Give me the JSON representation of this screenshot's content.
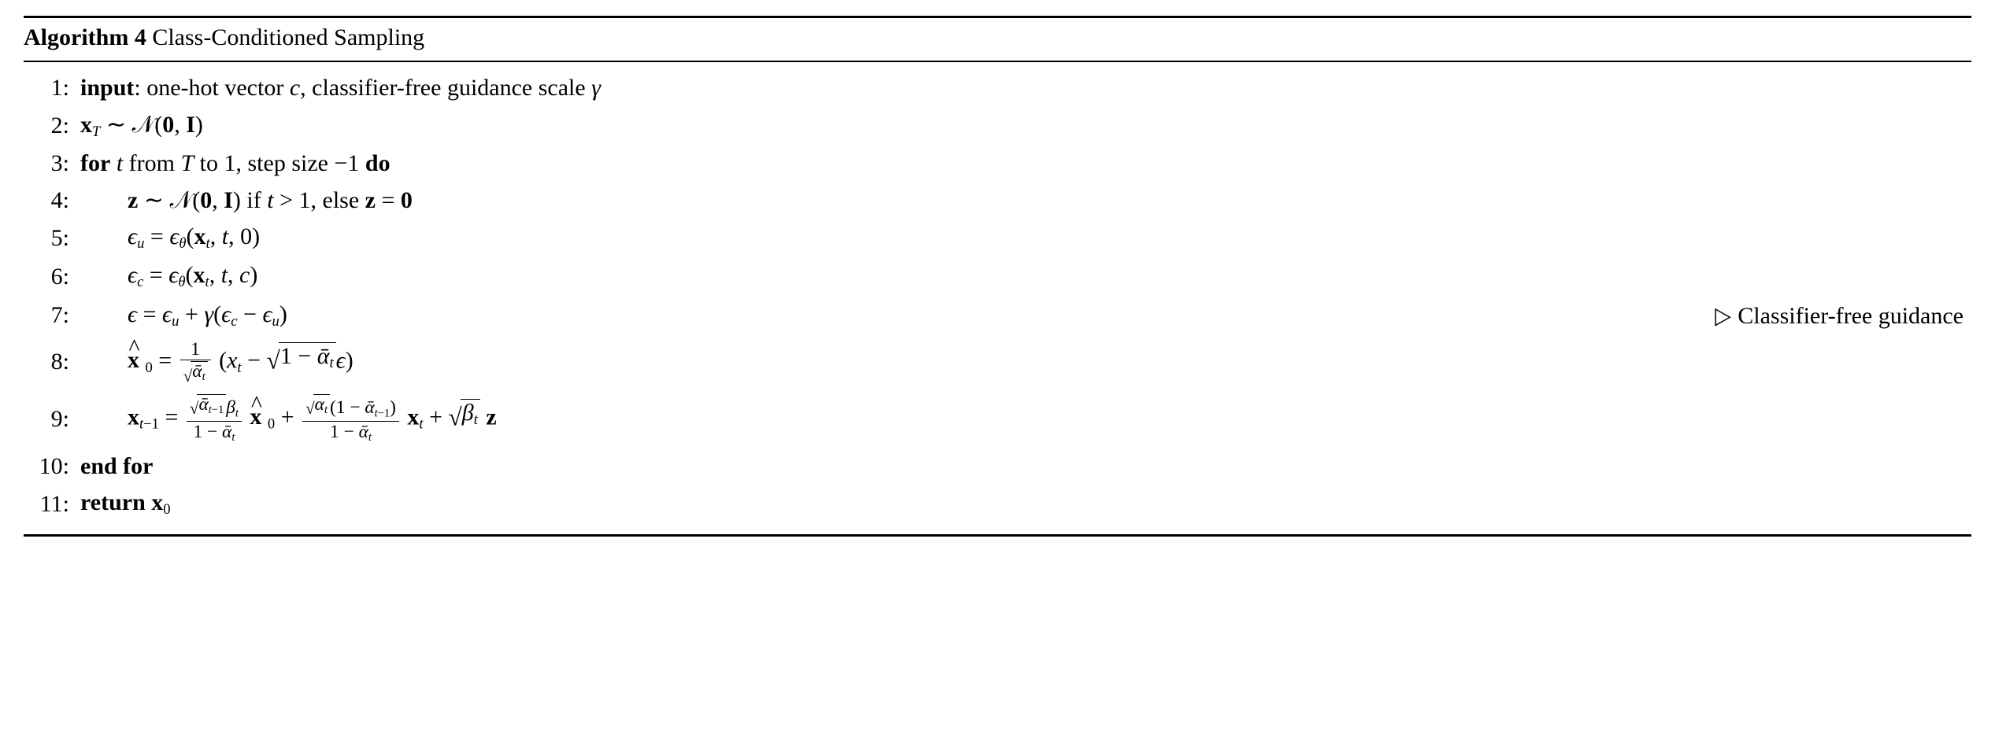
{
  "algorithm": {
    "number_label": "Algorithm 4",
    "title": "Class-Conditioned Sampling",
    "lines": {
      "n1": "1:",
      "n2": "2:",
      "n3": "3:",
      "n4": "4:",
      "n5": "5:",
      "n6": "6:",
      "n7": "7:",
      "n8": "8:",
      "n9": "9:",
      "n10": "10:",
      "n11": "11:"
    },
    "kw": {
      "input": "input",
      "for": "for",
      "do": "do",
      "endfor": "end for",
      "return": "return",
      "if": "if",
      "else": "else"
    },
    "text": {
      "input_desc_a": ": one-hot vector ",
      "input_desc_b": ", classifier-free guidance scale ",
      "from": " from ",
      "to1": " to 1, step size −1 ",
      "gt1": " > 1, "
    },
    "comment": {
      "cfg": "Classifier-free guidance"
    },
    "sym": {
      "c": "c",
      "gamma": "γ",
      "t": "t",
      "T": "T",
      "eps": "ϵ",
      "theta": "θ",
      "alpha": "α",
      "alphabar": "ᾱ",
      "beta": "β",
      "x": "x",
      "z": "z",
      "I": "I",
      "zero": "0",
      "N": "𝒩",
      "tilde": "∼",
      "hat": "^",
      "u": "u"
    }
  }
}
